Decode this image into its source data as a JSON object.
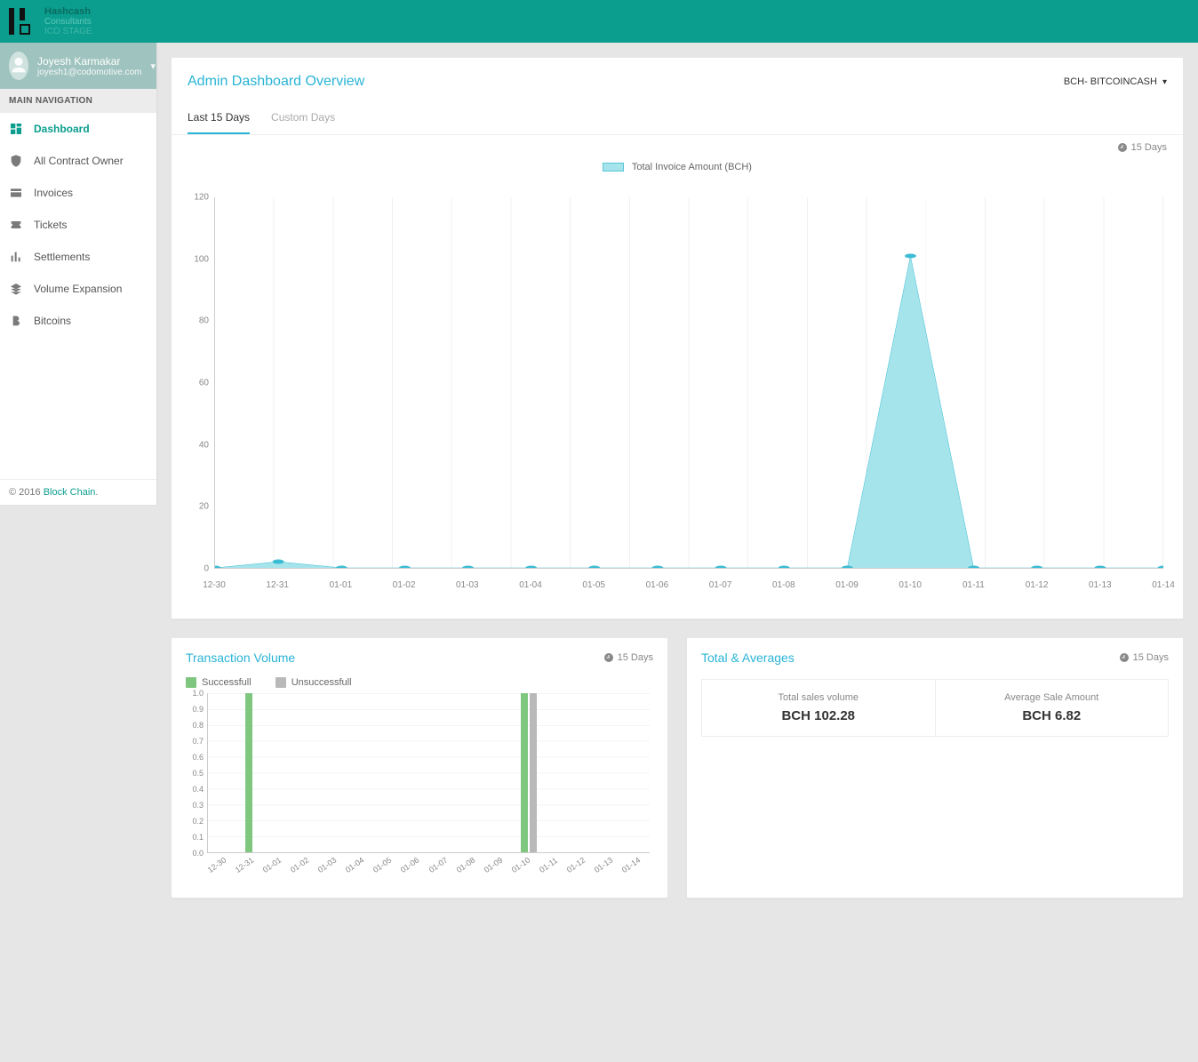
{
  "brand": {
    "line1": "Hashcash",
    "line2": "Consultants",
    "line3": "ICO STAGE"
  },
  "user": {
    "name": "Joyesh Karmakar",
    "email": "joyesh1@codomotive.com"
  },
  "sidebar": {
    "header": "MAIN NAVIGATION",
    "items": [
      {
        "label": "Dashboard"
      },
      {
        "label": "All Contract Owner"
      },
      {
        "label": "Invoices"
      },
      {
        "label": "Tickets"
      },
      {
        "label": "Settlements"
      },
      {
        "label": "Volume Expansion"
      },
      {
        "label": "Bitcoins"
      }
    ],
    "footer_prefix": "© 2016 ",
    "footer_link": "Block Chain",
    "footer_suffix": "."
  },
  "overview": {
    "title": "Admin Dashboard Overview",
    "crypto": "BCH- BITCOINCASH",
    "tabs": {
      "active": "Last 15 Days",
      "other": "Custom Days"
    },
    "badge": "15 Days",
    "legend": "Total Invoice Amount (BCH)"
  },
  "tx": {
    "title": "Transaction Volume",
    "badge": "15 Days",
    "legend": {
      "a": "Successfull",
      "b": "Unsuccessfull"
    }
  },
  "totals": {
    "title": "Total & Averages",
    "badge": "15 Days",
    "cells": [
      {
        "label": "Total sales volume",
        "value": "BCH 102.28"
      },
      {
        "label": "Average Sale Amount",
        "value": "BCH 6.82"
      }
    ]
  },
  "chart_data": [
    {
      "type": "area",
      "title": "Total Invoice Amount (BCH)",
      "series": [
        {
          "name": "Total Invoice Amount (BCH)",
          "values": [
            0,
            2,
            0,
            0,
            0,
            0,
            0,
            0,
            0,
            0,
            0,
            101,
            0,
            0,
            0,
            0
          ]
        }
      ],
      "categories": [
        "12-30",
        "12-31",
        "01-01",
        "01-02",
        "01-03",
        "01-04",
        "01-05",
        "01-06",
        "01-07",
        "01-08",
        "01-09",
        "01-10",
        "01-11",
        "01-12",
        "01-13",
        "01-14"
      ],
      "ylim": [
        0,
        120
      ],
      "yticks": [
        0,
        20,
        40,
        60,
        80,
        100,
        120
      ]
    },
    {
      "type": "bar",
      "title": "Transaction Volume",
      "series": [
        {
          "name": "Successfull",
          "values": [
            0,
            1,
            0,
            0,
            0,
            0,
            0,
            0,
            0,
            0,
            0,
            1,
            0,
            0,
            0,
            0
          ]
        },
        {
          "name": "Unsuccessfull",
          "values": [
            0,
            0,
            0,
            0,
            0,
            0,
            0,
            0,
            0,
            0,
            0,
            1,
            0,
            0,
            0,
            0
          ]
        }
      ],
      "categories": [
        "12-30",
        "12-31",
        "01-01",
        "01-02",
        "01-03",
        "01-04",
        "01-05",
        "01-06",
        "01-07",
        "01-08",
        "01-09",
        "01-10",
        "01-11",
        "01-12",
        "01-13",
        "01-14"
      ],
      "ylim": [
        0,
        1.0
      ],
      "yticks": [
        0,
        0.1,
        0.2,
        0.3,
        0.4,
        0.5,
        0.6,
        0.7,
        0.8,
        0.9,
        1.0
      ]
    }
  ]
}
